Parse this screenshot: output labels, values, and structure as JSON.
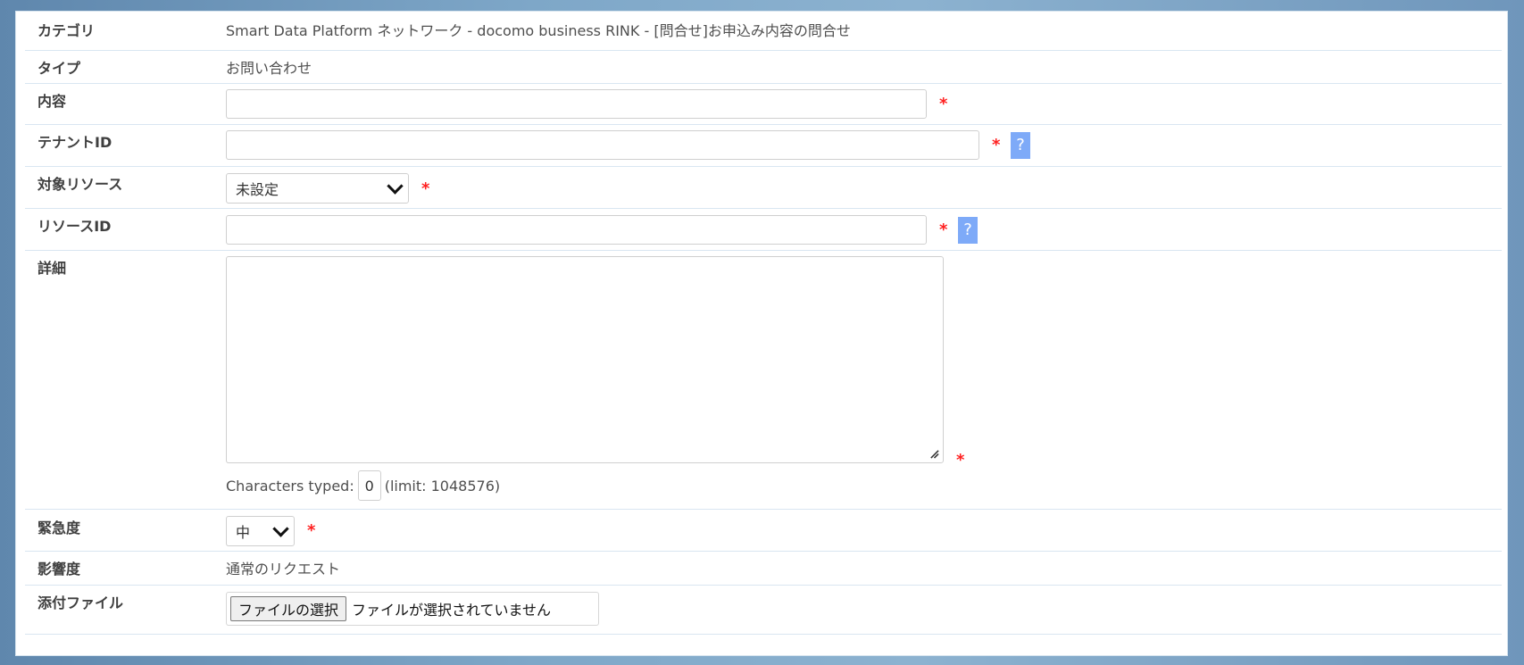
{
  "rows": {
    "category": {
      "label": "カテゴリ",
      "value": "Smart Data Platform ネットワーク - docomo business RINK - [問合せ]お申込み内容の問合せ"
    },
    "type": {
      "label": "タイプ",
      "value": "お問い合わせ"
    },
    "content": {
      "label": "内容",
      "value": ""
    },
    "tenant_id": {
      "label": "テナントID",
      "value": "",
      "help": "?"
    },
    "target_resource": {
      "label": "対象リソース",
      "selected": "未設定"
    },
    "resource_id": {
      "label": "リソースID",
      "value": "",
      "help": "?"
    },
    "details": {
      "label": "詳細",
      "counter_label": "Characters typed:",
      "counter_value": "0",
      "limit_text": "(limit: 1048576)"
    },
    "urgency": {
      "label": "緊急度",
      "selected": "中"
    },
    "impact": {
      "label": "影響度",
      "value": "通常のリクエスト"
    },
    "attachment": {
      "label": "添付ファイル",
      "button_label": "ファイルの選択",
      "status_text": "ファイルが選択されていません"
    }
  },
  "required_mark": "*",
  "colors": {
    "required": "#ff2020",
    "help_badge": "#7eaaf8",
    "row_divider": "#d9e6f1"
  },
  "icons": {
    "dropdown": "chevron-down-icon",
    "textarea_resize": "resize-handle-icon"
  }
}
